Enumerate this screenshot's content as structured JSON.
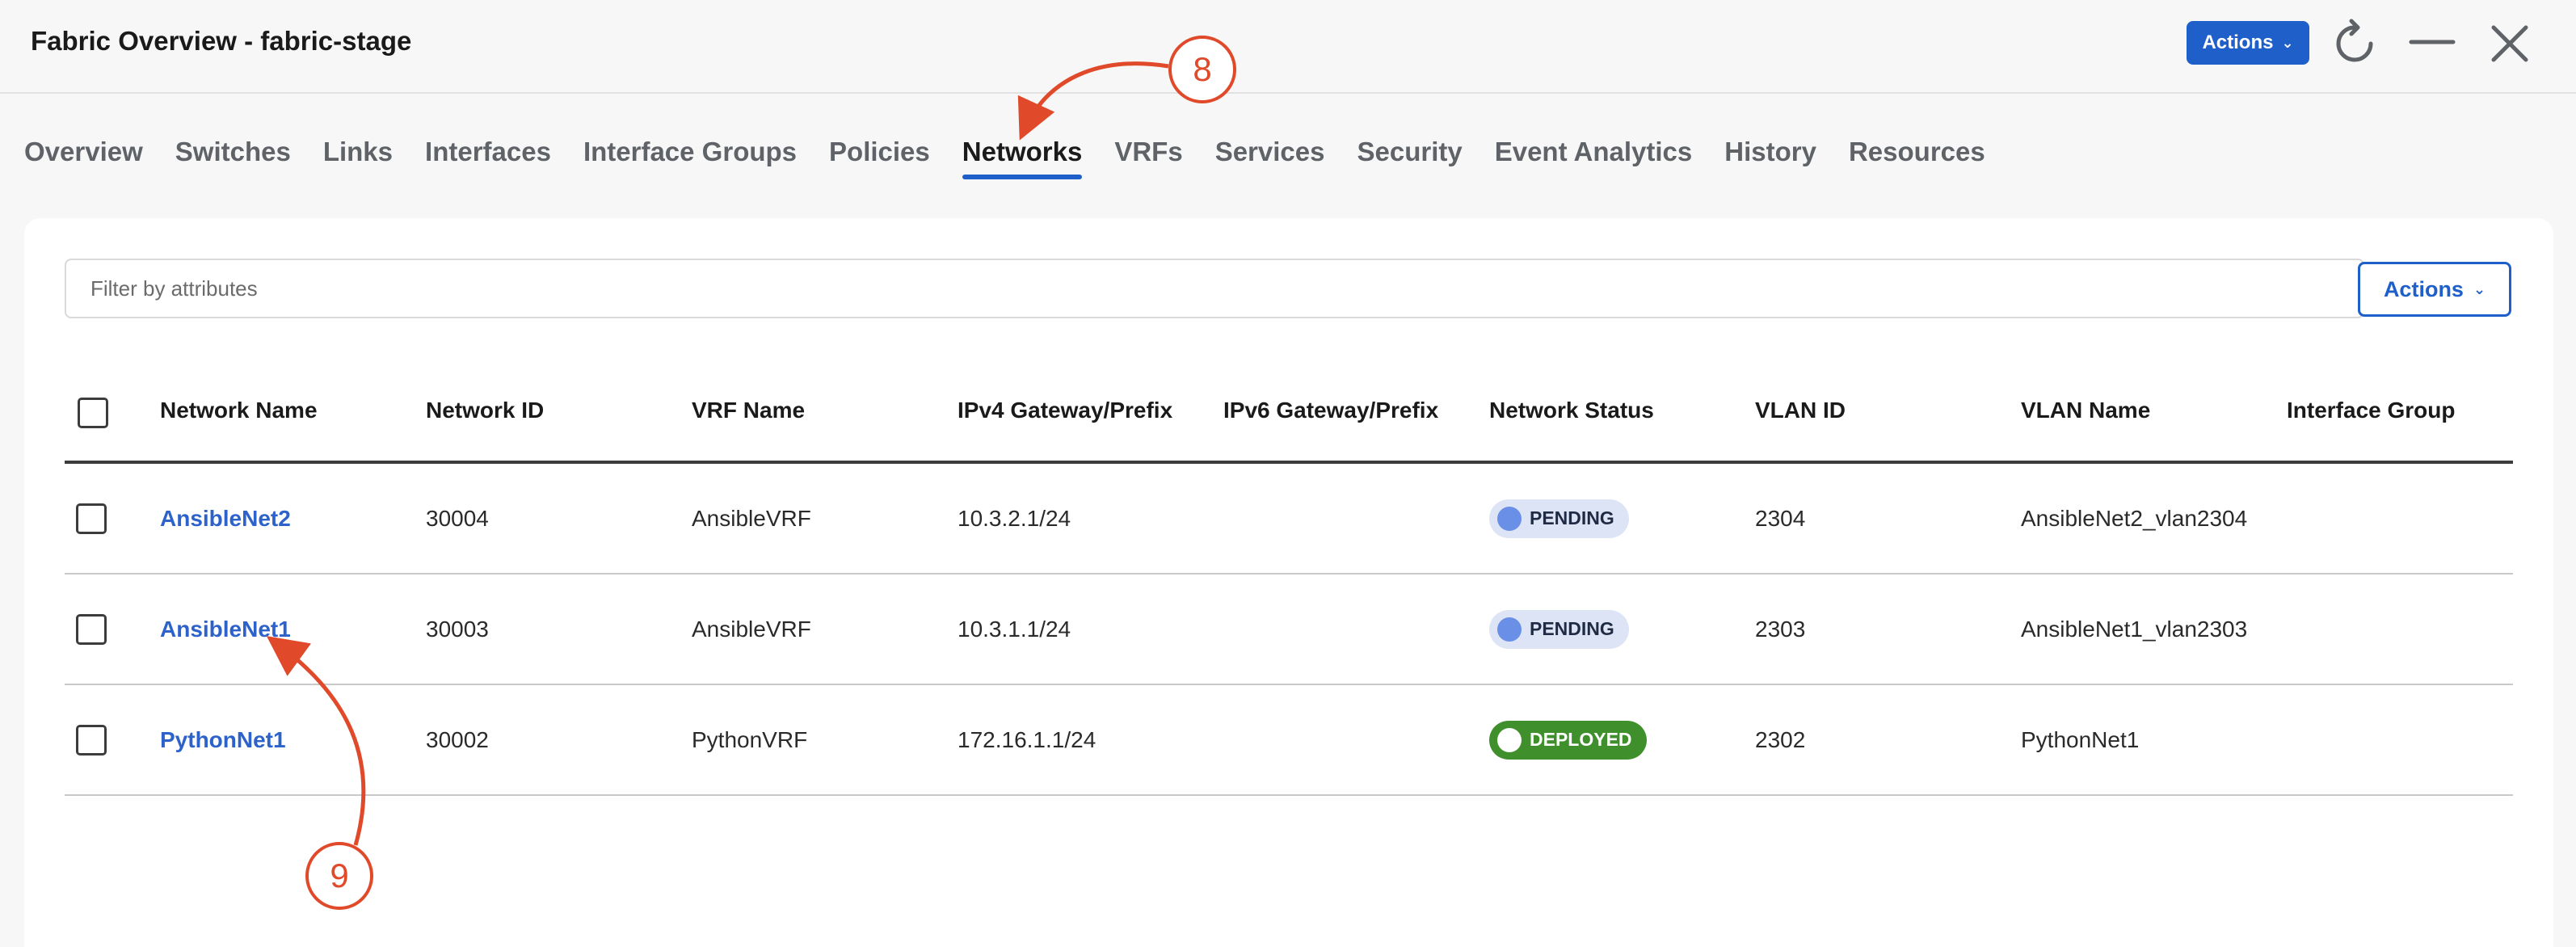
{
  "window": {
    "title": "Fabric Overview - fabric-stage",
    "actions_label": "Actions"
  },
  "tabs": [
    {
      "label": "Overview",
      "active": false
    },
    {
      "label": "Switches",
      "active": false
    },
    {
      "label": "Links",
      "active": false
    },
    {
      "label": "Interfaces",
      "active": false
    },
    {
      "label": "Interface Groups",
      "active": false
    },
    {
      "label": "Policies",
      "active": false
    },
    {
      "label": "Networks",
      "active": true
    },
    {
      "label": "VRFs",
      "active": false
    },
    {
      "label": "Services",
      "active": false
    },
    {
      "label": "Security",
      "active": false
    },
    {
      "label": "Event Analytics",
      "active": false
    },
    {
      "label": "History",
      "active": false
    },
    {
      "label": "Resources",
      "active": false
    }
  ],
  "toolbar": {
    "filter_placeholder": "Filter by attributes",
    "actions_label": "Actions"
  },
  "table": {
    "columns": [
      "Network Name",
      "Network ID",
      "VRF Name",
      "IPv4 Gateway/Prefix",
      "IPv6 Gateway/Prefix",
      "Network Status",
      "VLAN ID",
      "VLAN Name",
      "Interface Group"
    ],
    "rows": [
      {
        "name": "AnsibleNet2",
        "id": "30004",
        "vrf": "AnsibleVRF",
        "ipv4": "10.3.2.1/24",
        "ipv6": "",
        "status": "PENDING",
        "vlan_id": "2304",
        "vlan_name": "AnsibleNet2_vlan2304",
        "iface_group": ""
      },
      {
        "name": "AnsibleNet1",
        "id": "30003",
        "vrf": "AnsibleVRF",
        "ipv4": "10.3.1.1/24",
        "ipv6": "",
        "status": "PENDING",
        "vlan_id": "2303",
        "vlan_name": "AnsibleNet1_vlan2303",
        "iface_group": ""
      },
      {
        "name": "PythonNet1",
        "id": "30002",
        "vrf": "PythonVRF",
        "ipv4": "172.16.1.1/24",
        "ipv6": "",
        "status": "DEPLOYED",
        "vlan_id": "2302",
        "vlan_name": "PythonNet1",
        "iface_group": ""
      }
    ]
  },
  "annotations": [
    {
      "label": "8"
    },
    {
      "label": "9"
    }
  ],
  "colors": {
    "accent": "#1f5fc9",
    "link": "#2c62c9",
    "pending_bg": "#dce4f5",
    "deployed_bg": "#3f8f2c",
    "annotation": "#e04a2a"
  },
  "icons": [
    "refresh-icon",
    "minimize-icon",
    "close-icon",
    "chevron-down-icon"
  ]
}
